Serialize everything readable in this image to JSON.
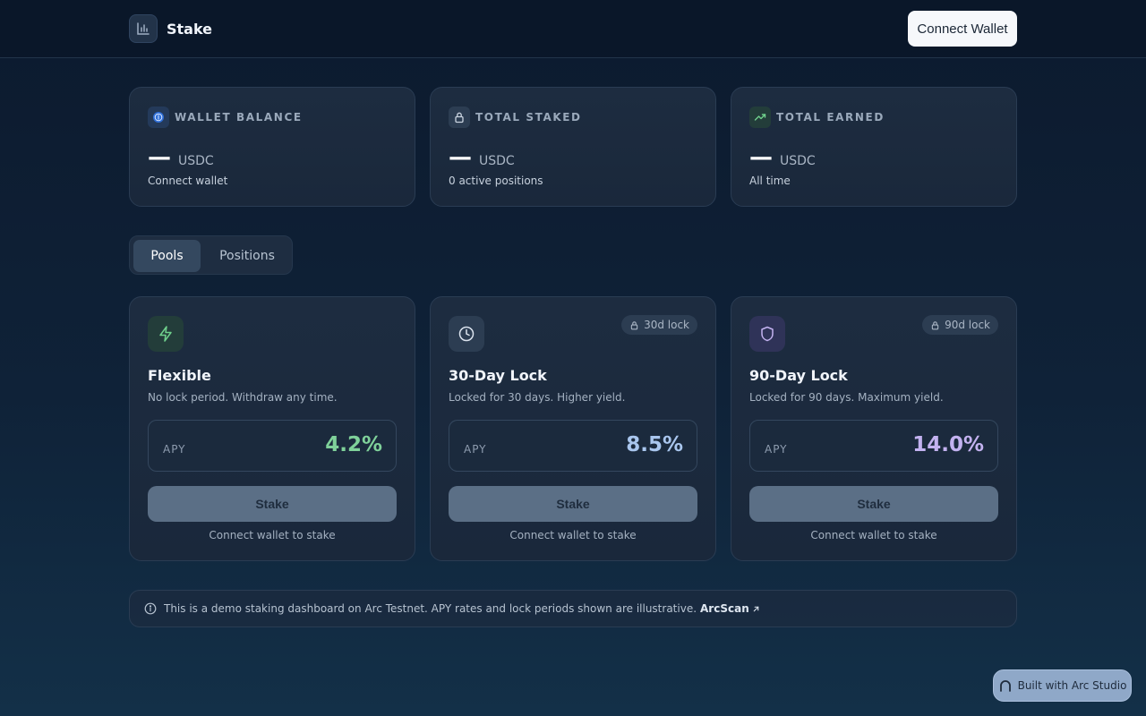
{
  "header": {
    "brand_name": "Stake",
    "brand_icon": "bar-chart-icon",
    "connect_label": "Connect Wallet"
  },
  "stats": [
    {
      "label": "WALLET BALANCE",
      "value": "—",
      "unit": "USDC",
      "sub": "Connect wallet",
      "icon": "usdc-icon",
      "accent": "#3b82f6"
    },
    {
      "label": "TOTAL STAKED",
      "value": "—",
      "unit": "USDC",
      "sub": "0 active positions",
      "icon": "lock-icon",
      "accent": "#c9d3df"
    },
    {
      "label": "TOTAL EARNED",
      "value": "—",
      "unit": "USDC",
      "sub": "All time",
      "icon": "trending-up-icon",
      "accent": "#6fd08c"
    }
  ],
  "tabs": {
    "pools": "Pools",
    "positions": "Positions",
    "active": "Pools"
  },
  "pools": [
    {
      "title": "Flexible",
      "desc": "No lock period. Withdraw any time.",
      "apy_label": "APY",
      "apy": "4.2%",
      "apy_color": "#7fd19a",
      "lock": "",
      "icon": "zap-icon",
      "stake_label": "Stake",
      "hint": "Connect wallet to stake"
    },
    {
      "title": "30-Day Lock",
      "desc": "Locked for 30 days. Higher yield.",
      "apy_label": "APY",
      "apy": "8.5%",
      "apy_color": "#a9c6ee",
      "lock": "30d lock",
      "icon": "clock-icon",
      "stake_label": "Stake",
      "hint": "Connect wallet to stake"
    },
    {
      "title": "90-Day Lock",
      "desc": "Locked for 90 days. Maximum yield.",
      "apy_label": "APY",
      "apy": "14.0%",
      "apy_color": "#c3b2f0",
      "lock": "90d lock",
      "icon": "shield-icon",
      "stake_label": "Stake",
      "hint": "Connect wallet to stake"
    }
  ],
  "notice": {
    "text": "This is a demo staking dashboard on Arc Testnet. APY rates and lock periods shown are illustrative.",
    "link": "ArcScan"
  },
  "badge": {
    "label": "Built with Arc Studio"
  }
}
